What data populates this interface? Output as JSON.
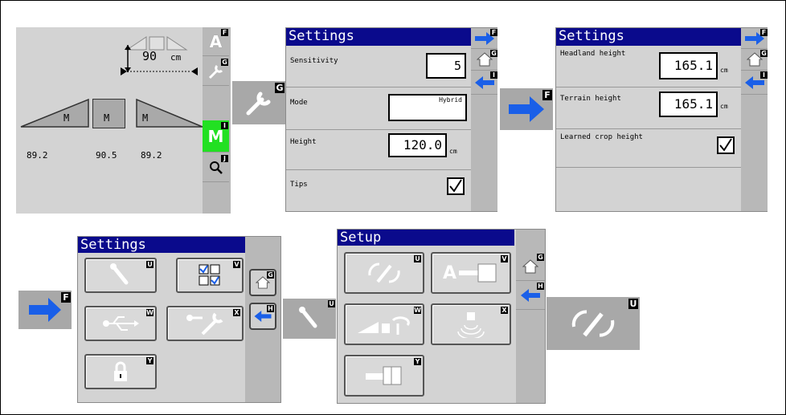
{
  "view1": {
    "height_value": "90",
    "height_unit": "cm",
    "section_labels": [
      "M",
      "M",
      "M"
    ],
    "readings": [
      "89.2",
      "90.5",
      "89.2"
    ],
    "keys": [
      "F",
      "G",
      "I",
      "J"
    ],
    "mode_letter": "M"
  },
  "settings1": {
    "title": "Settings",
    "rows": [
      {
        "label": "Sensitivity",
        "value": "5"
      },
      {
        "label": "Mode",
        "value": "Hybrid"
      },
      {
        "label": "Height",
        "value": "120.0",
        "unit": "cm"
      },
      {
        "label": "Tips"
      }
    ],
    "keys": [
      "F",
      "G",
      "I"
    ]
  },
  "settings2": {
    "title": "Settings",
    "rows": [
      {
        "label": "Headland height",
        "value": "165.1",
        "unit": "cm"
      },
      {
        "label": "Terrain height",
        "value": "165.1",
        "unit": "cm"
      },
      {
        "label": "Learned crop height"
      }
    ],
    "keys": [
      "F",
      "G",
      "I"
    ]
  },
  "settings3": {
    "title": "Settings",
    "tile_keys": [
      "U",
      "V",
      "W",
      "X",
      "Y"
    ],
    "side_keys": [
      "G",
      "H"
    ]
  },
  "setup": {
    "title": "Setup",
    "tile_keys": [
      "U",
      "V",
      "W",
      "X",
      "Y"
    ],
    "side_keys": [
      "G",
      "H"
    ]
  },
  "callouts": {
    "wrench_key": "G",
    "arrow_key": "F",
    "arrow_key2": "F",
    "wrench_key2": "U",
    "sync_key": "U"
  },
  "colors": {
    "title_bar": "#0a0a8c",
    "arrow": "#1a5fe8",
    "mode_active": "#22e022"
  }
}
